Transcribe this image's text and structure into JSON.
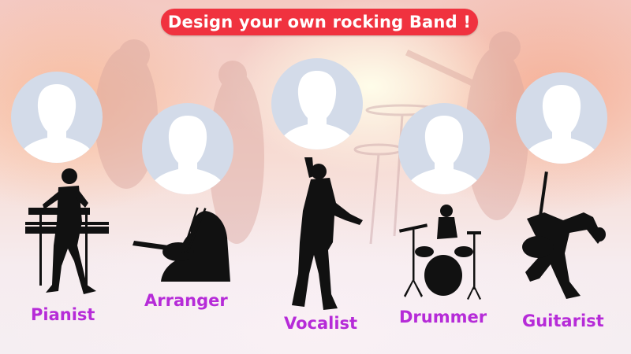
{
  "title": "Design your own rocking Band !",
  "colors": {
    "title_bg": "#f0323f",
    "label": "#b62bd8",
    "avatar_bg": "#d3dbe9",
    "silhouette": "#111111"
  },
  "members": [
    {
      "role": "Pianist",
      "icon": "pianist-silhouette"
    },
    {
      "role": "Arranger",
      "icon": "violinist-silhouette"
    },
    {
      "role": "Vocalist",
      "icon": "singer-silhouette"
    },
    {
      "role": "Drummer",
      "icon": "drummer-silhouette"
    },
    {
      "role": "Guitarist",
      "icon": "guitarist-silhouette"
    }
  ]
}
